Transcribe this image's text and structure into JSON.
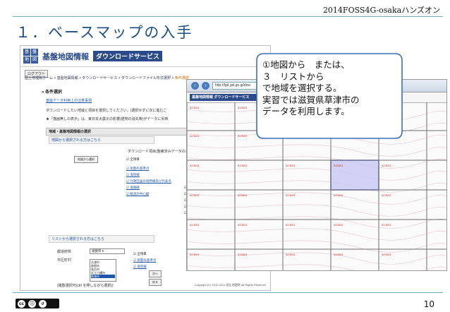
{
  "slide": {
    "header": "2014FOSS4G-osakaハンズオン",
    "title": "１．ベースマップの入手",
    "page_number": "10",
    "license_icon": "cc-by-sa-badge"
  },
  "shot1": {
    "logo_chars": [
      "基",
      "盤",
      "地",
      "図"
    ],
    "site_title": "基盤地図情報",
    "service_title": "ダウンロードサービス",
    "login_label": "ログアウト",
    "breadcrumb": [
      "国土地理院ホーム",
      "基盤地図情報",
      "ダウンロードサービス",
      "ダウンロードファイル形式選択"
    ],
    "breadcrumb_current": "条件選択",
    "section_heading": "条件選択",
    "notice_link": "基盤データ利用上の注意事項",
    "intro_line": "ダウンロードしたい地域と項目を選択してください。(選択せずに次に進むこ",
    "warning_line": "★「描画無しの表示」は、東日本大震災の影響(建物の消失等)がデータに反映",
    "box_heading": "地域・基盤地図情報の選択",
    "map_panel_head": "地図から選択される方はこちら",
    "map_select_button": "地図から選択",
    "download_items_head": "ダウンロード項目(整備済みデータのみ表示",
    "select_all": "全項目",
    "items": [
      "測量の基準点",
      "海岸線",
      "行政区画の境界線及び代表点",
      "道路縁",
      "軌道の中心線"
    ],
    "list_panel_head": "リストから選択される方はこちら",
    "pref_label": "都道府県",
    "pref_value": "滋賀県",
    "city_label": "市区町村",
    "city_options": [
      "大津市",
      "彦根市",
      "長浜市",
      "近江八幡市",
      "草津市"
    ],
    "city_selected": "草津市",
    "range_note": "(複数選択可(ctrl を押しながら選択))",
    "next_button": "次へ",
    "back_button": "戻る",
    "copyright": "Copyright (C) 2013-2014 国土地理院 All Rights Reserved"
  },
  "shot2": {
    "url": "http://fgd.gsi.go.jp/dow",
    "tab_title": "基盤地図情報 ダウンロードサービス",
    "cell_label": "523503",
    "highlight_color": "#c8c8f4",
    "grid_color": "#6f6f6f"
  },
  "callout": {
    "lines": [
      "①地図から　または、",
      "３　リストから",
      "で地域を選択する。",
      "実習では滋賀県草津市の",
      "データを利用します。"
    ]
  }
}
